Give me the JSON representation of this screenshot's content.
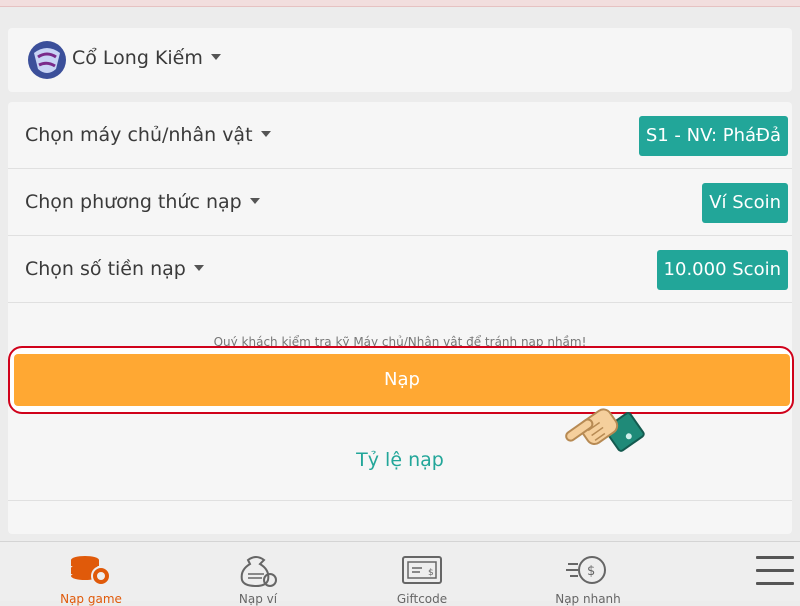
{
  "game": {
    "name": "Cổ Long Kiếm",
    "logo_icon": "co-long-kiem-logo-icon"
  },
  "form": {
    "rows": [
      {
        "label": "Chọn máy chủ/nhân vật",
        "value": "S1 - NV: PháĐả"
      },
      {
        "label": "Chọn phương thức nạp",
        "value": "Ví Scoin"
      },
      {
        "label": "Chọn số tiền nạp",
        "value": "10.000 Scoin"
      }
    ],
    "notice": "Quý khách kiểm tra kỹ Máy chủ/Nhân vật để tránh nạp nhầm!",
    "submit_label": "Nạp",
    "rate_link": "Tỷ lệ nạp"
  },
  "nav": {
    "items": [
      {
        "label": "Nạp game",
        "icon": "coins-icon"
      },
      {
        "label": "Nạp ví",
        "icon": "money-bag-icon"
      },
      {
        "label": "Giftcode",
        "icon": "ticket-icon"
      },
      {
        "label": "Nạp nhanh",
        "icon": "fast-coin-icon"
      }
    ],
    "menu_icon": "hamburger-menu-icon"
  },
  "colors": {
    "accent_teal": "#22a699",
    "submit_orange": "#ffa833",
    "active_nav": "#e05a0a",
    "highlight_outline": "#d0021b"
  }
}
